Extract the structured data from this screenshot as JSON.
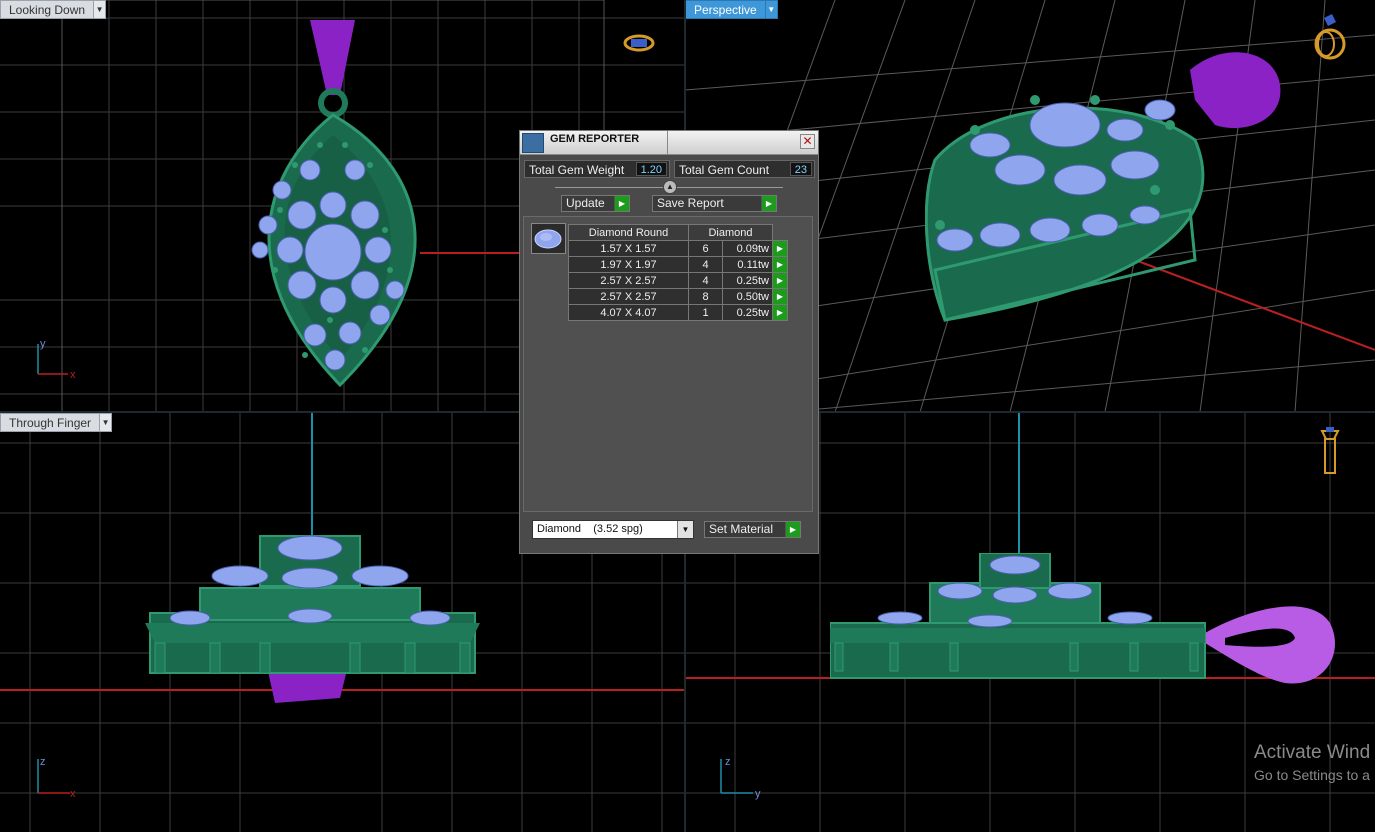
{
  "viewports": {
    "top_left": {
      "label": "Looking Down",
      "active": false,
      "axis_v": "y",
      "axis_h": "x"
    },
    "top_right": {
      "label": "Perspective",
      "active": true
    },
    "bottom_left": {
      "label": "Through Finger",
      "active": false,
      "axis_v": "z",
      "axis_h": "x"
    },
    "bottom_right": {
      "axis_v": "z",
      "axis_h": "y"
    }
  },
  "gem_reporter": {
    "title": "GEM REPORTER",
    "total_weight_label": "Total Gem Weight",
    "total_weight_value": "1.20",
    "total_count_label": "Total Gem Count",
    "total_count_value": "23",
    "update_label": "Update",
    "save_label": "Save Report",
    "table": {
      "header_shape": "Diamond Round",
      "header_material": "Diamond",
      "rows": [
        {
          "size": "1.57 X 1.57",
          "count": "6",
          "weight": "0.09tw"
        },
        {
          "size": "1.97 X 1.97",
          "count": "4",
          "weight": "0.11tw"
        },
        {
          "size": "2.57 X 2.57",
          "count": "4",
          "weight": "0.25tw"
        },
        {
          "size": "2.57 X 2.57",
          "count": "8",
          "weight": "0.50tw"
        },
        {
          "size": "4.07 X 4.07",
          "count": "1",
          "weight": "0.25tw"
        }
      ]
    },
    "material_select": "Diamond    (3.52 spg)",
    "set_material_label": "Set Material"
  },
  "watermark": {
    "line1": "Activate Wind",
    "line2": "Go to Settings to a"
  },
  "colors": {
    "metal": "#1f7a5a",
    "gem": "#8fa6ee",
    "bail": "#8a22c6",
    "axis_red": "#b82020",
    "axis_cyan": "#1e8fa8",
    "active_label": "#3d97d8"
  },
  "icons": {
    "top_left": "ring-top-view-icon",
    "top_right": "ring-perspective-icon",
    "bottom_right": "ring-side-view-icon"
  }
}
